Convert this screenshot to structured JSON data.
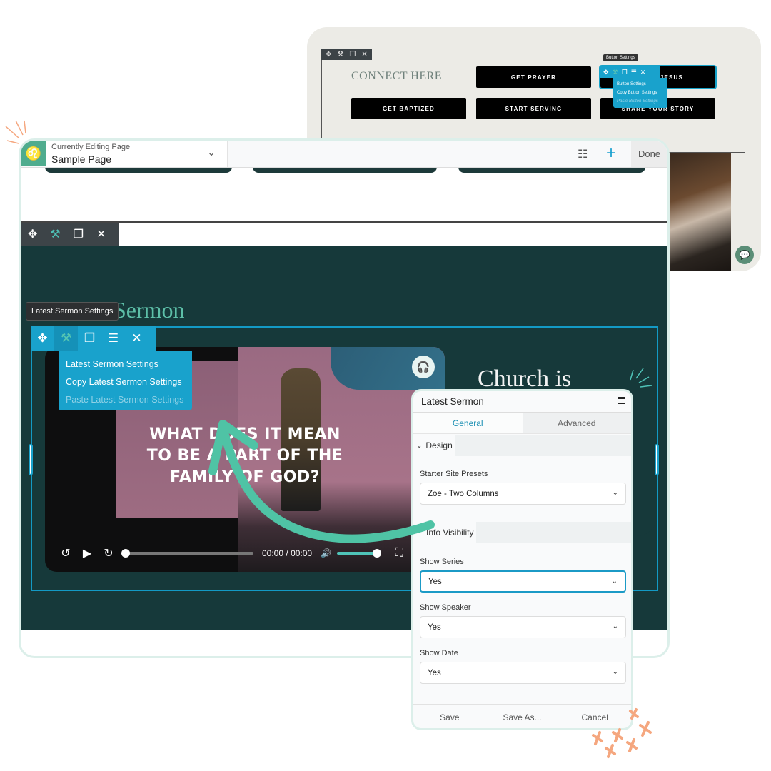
{
  "back_preview": {
    "section_title": "CONNECT HERE",
    "toolbar_icons": [
      "move-icon",
      "wrench-icon",
      "duplicate-icon",
      "close-icon"
    ],
    "buttons": [
      "GET PRAYER",
      "JESUS",
      "GET BAPTIZED",
      "START SERVING",
      "SHARE YOUR STORY"
    ],
    "button_tooltip": "Button Settings",
    "button_menu": [
      "Button Settings",
      "Copy Button Settings",
      "Paste Button Settings"
    ]
  },
  "topbar": {
    "editing_label": "Currently Editing Page",
    "page_name": "Sample Page",
    "done_label": "Done"
  },
  "row_toolbar": {
    "icons": [
      "move-icon",
      "wrench-icon",
      "duplicate-icon",
      "close-icon"
    ]
  },
  "section": {
    "title": "Sermon",
    "tooltip": "Latest Sermon Settings",
    "module_menu": [
      "Latest Sermon Settings",
      "Copy Latest Sermon Settings",
      "Paste Latest Sermon Settings"
    ],
    "side_heading": "Church is"
  },
  "video": {
    "title_lines": [
      "WHAT DOES IT MEAN",
      "TO BE A PART OF THE",
      "FAMILY OF GOD?"
    ],
    "current_time": "00:00",
    "separator": "/",
    "duration": "00:00",
    "progress": 0,
    "volume": 1
  },
  "panel": {
    "title": "Latest Sermon",
    "tabs": [
      {
        "label": "General",
        "active": true
      },
      {
        "label": "Advanced",
        "active": false
      }
    ],
    "design_section": "Design",
    "starter_label": "Starter Site Presets",
    "starter_value": "Zoe - Two Columns",
    "info_section": "Info Visibility",
    "fields": [
      {
        "label": "Show Series",
        "value": "Yes"
      },
      {
        "label": "Show Speaker",
        "value": "Yes"
      },
      {
        "label": "Show Date",
        "value": "Yes"
      }
    ],
    "footer": {
      "save": "Save",
      "save_as": "Save As...",
      "cancel": "Cancel"
    }
  },
  "colors": {
    "accent_blue": "#19a2cc",
    "teal_arrow": "#4fc3a5",
    "dark_section": "#16393a",
    "decor_orange": "#f5a77f"
  }
}
